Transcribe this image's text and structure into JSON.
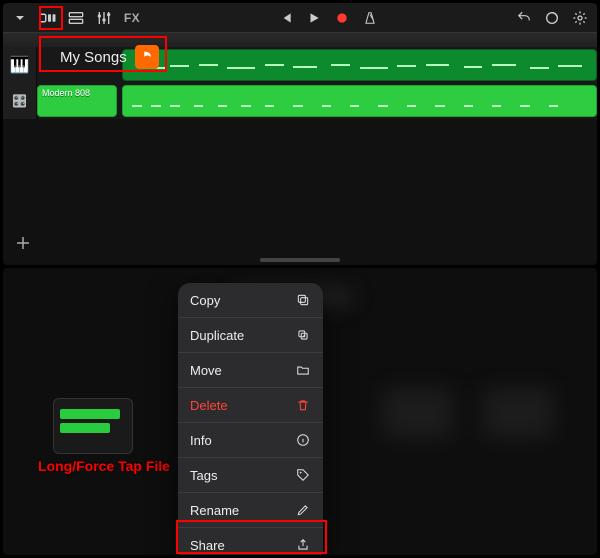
{
  "toolbar": {
    "fx_label": "FX"
  },
  "mysongs_label": "My Songs",
  "track2_label": "Modern 808",
  "annotation_tap": "Long/Force Tap File",
  "menu": {
    "items": [
      {
        "label": "Copy",
        "icon": "copy-icon"
      },
      {
        "label": "Duplicate",
        "icon": "duplicate-icon"
      },
      {
        "label": "Move",
        "icon": "folder-icon"
      },
      {
        "label": "Delete",
        "icon": "trash-icon",
        "danger": true
      },
      {
        "label": "Info",
        "icon": "info-icon"
      },
      {
        "label": "Tags",
        "icon": "tag-icon"
      },
      {
        "label": "Rename",
        "icon": "pencil-icon"
      },
      {
        "label": "Share",
        "icon": "share-icon"
      }
    ]
  }
}
